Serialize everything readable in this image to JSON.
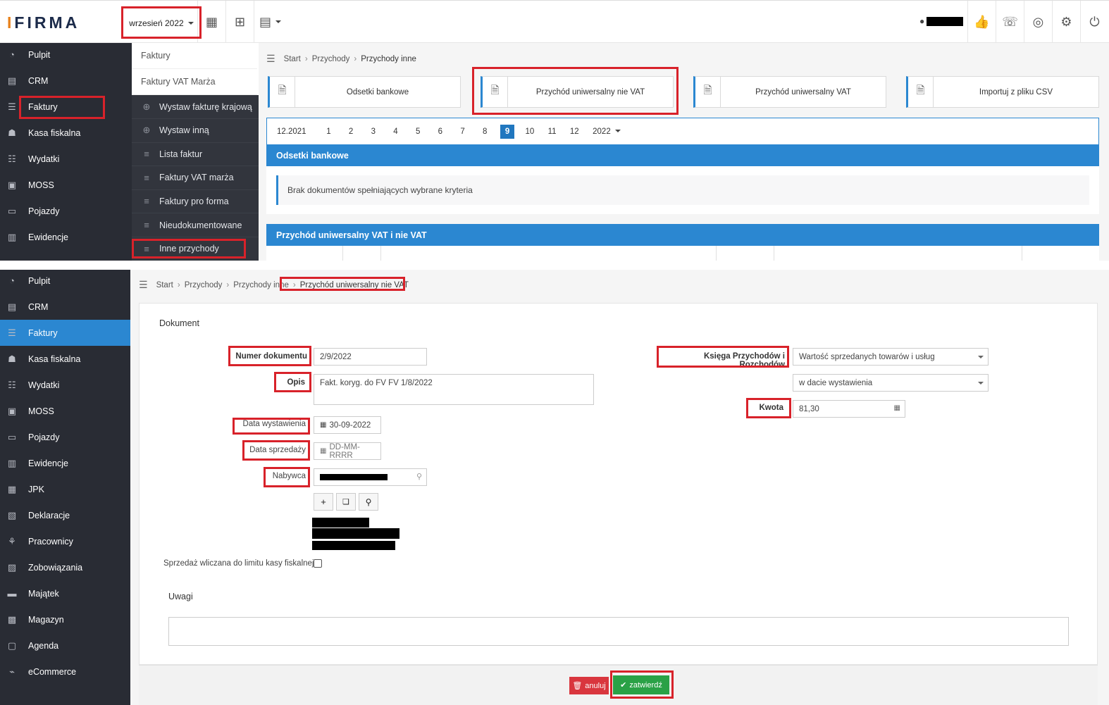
{
  "brand": "IFIRMA",
  "period": {
    "label": "wrzesień 2022"
  },
  "colors": {
    "accent": "#2b87d1",
    "sidebar": "#292c34",
    "highlight": "#d8222a",
    "success": "#2aa146",
    "danger": "#d9363e"
  },
  "top_sidebar": [
    {
      "label": "Pulpit",
      "icon": "dashboard-icon"
    },
    {
      "label": "CRM",
      "icon": "crm-icon"
    },
    {
      "label": "Faktury",
      "icon": "invoice-icon"
    },
    {
      "label": "Kasa fiskalna",
      "icon": "cash-register-icon"
    },
    {
      "label": "Wydatki",
      "icon": "expenses-icon"
    },
    {
      "label": "MOSS",
      "icon": "moss-icon"
    },
    {
      "label": "Pojazdy",
      "icon": "car-icon"
    },
    {
      "label": "Ewidencje",
      "icon": "records-icon"
    }
  ],
  "submenu": {
    "light": [
      "Faktury",
      "Faktury VAT Marża"
    ],
    "dark": [
      {
        "label": "Wystaw fakturę krajową",
        "icon": "plus-circle-icon"
      },
      {
        "label": "Wystaw inną",
        "icon": "plus-circle-icon"
      },
      {
        "label": "Lista faktur",
        "icon": "list-icon"
      },
      {
        "label": "Faktury VAT marża",
        "icon": "list-icon"
      },
      {
        "label": "Faktury pro forma",
        "icon": "list-icon"
      },
      {
        "label": "Nieudokumentowane",
        "icon": "list-icon"
      },
      {
        "label": "Inne przychody",
        "icon": "list-icon"
      }
    ]
  },
  "top_breadcrumb": [
    "Start",
    "Przychody",
    "Przychody inne"
  ],
  "tiles": [
    {
      "label": "Odsetki bankowe",
      "icon": "document-icon"
    },
    {
      "label": "Przychód uniwersalny nie VAT",
      "icon": "document-gear-icon"
    },
    {
      "label": "Przychód uniwersalny VAT",
      "icon": "document-gear-icon"
    },
    {
      "label": "Importuj z pliku CSV",
      "icon": "document-gear-icon"
    }
  ],
  "months": {
    "prev": "12.2021",
    "items": [
      "1",
      "2",
      "3",
      "4",
      "5",
      "6",
      "7",
      "8",
      "9",
      "10",
      "11",
      "12"
    ],
    "selected": "9",
    "year": "2022"
  },
  "panels": {
    "interest_title": "Odsetki bankowe",
    "empty_text": "Brak dokumentów spełniających wybrane kryteria",
    "universal_title": "Przychód uniwersalny VAT i nie VAT"
  },
  "bottom_sidebar": [
    {
      "label": "Pulpit",
      "icon": "dashboard-icon"
    },
    {
      "label": "CRM",
      "icon": "crm-icon"
    },
    {
      "label": "Faktury",
      "icon": "invoice-icon",
      "active": true
    },
    {
      "label": "Kasa fiskalna",
      "icon": "cash-register-icon"
    },
    {
      "label": "Wydatki",
      "icon": "expenses-icon"
    },
    {
      "label": "MOSS",
      "icon": "moss-icon"
    },
    {
      "label": "Pojazdy",
      "icon": "car-icon"
    },
    {
      "label": "Ewidencje",
      "icon": "records-icon"
    },
    {
      "label": "JPK",
      "icon": "jpk-icon"
    },
    {
      "label": "Deklaracje",
      "icon": "declarations-icon"
    },
    {
      "label": "Pracownicy",
      "icon": "employees-icon"
    },
    {
      "label": "Zobowiązania",
      "icon": "liabilities-icon"
    },
    {
      "label": "Majątek",
      "icon": "assets-icon"
    },
    {
      "label": "Magazyn",
      "icon": "warehouse-icon"
    },
    {
      "label": "Agenda",
      "icon": "agenda-icon"
    },
    {
      "label": "eCommerce",
      "icon": "cart-icon"
    }
  ],
  "bottom_breadcrumb": [
    "Start",
    "Przychody",
    "Przychody inne",
    "Przychód uniwersalny nie VAT"
  ],
  "form": {
    "section_title": "Dokument",
    "numer_label": "Numer dokumentu",
    "numer_value": "2/9/2022",
    "opis_label": "Opis",
    "opis_value": "Fakt. koryg. do FV FV 1/8/2022",
    "data_wyst_label": "Data wystawienia",
    "data_wyst_value": "30-09-2022",
    "data_sprz_label": "Data sprzedaży",
    "data_sprz_placeholder": "DD-MM-RRRR",
    "nabywca_label": "Nabywca",
    "ksiega_label": "Księga Przychodów i Rozchodów",
    "ksiega_value": "Wartość sprzedanych towarów i usług",
    "when_value": "w dacie wystawienia",
    "kwota_label": "Kwota",
    "kwota_value": "81,30",
    "kasa_label": "Sprzedaż wliczana do limitu kasy fiskalnej",
    "kasa_checked": false,
    "uwagi_title": "Uwagi",
    "uwagi_value": ""
  },
  "buttons": {
    "cancel": "anuluj",
    "confirm": "zatwierdź"
  }
}
